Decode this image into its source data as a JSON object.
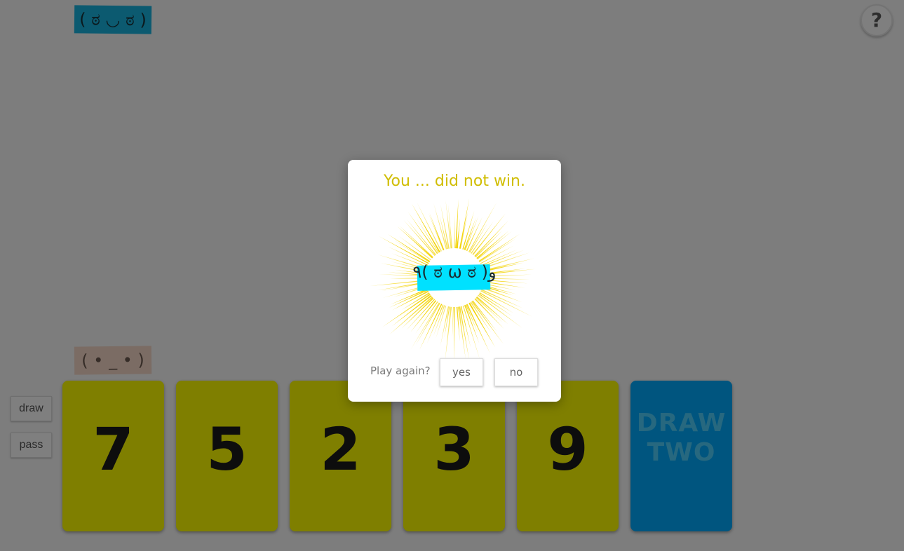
{
  "opponent": {
    "emoticon": "( ಠ ◡ ಠ )",
    "sticker_color": "#19b4e0"
  },
  "player": {
    "emoticon": "( • _ • )",
    "sticker_color": "#f6d8c8"
  },
  "help": {
    "label": "?"
  },
  "controls": {
    "draw_label": "draw",
    "pass_label": "pass"
  },
  "hand": [
    {
      "value": "7",
      "color": "#ffff00"
    },
    {
      "value": "5",
      "color": "#ffff00"
    },
    {
      "value": "2",
      "color": "#ffff00"
    },
    {
      "value": "3",
      "color": "#ffff00"
    },
    {
      "value": "9",
      "color": "#ffff00"
    },
    {
      "value": "DRAW TWO",
      "line1": "DRAW",
      "line2": "TWO",
      "color": "#00aaff"
    }
  ],
  "dialog": {
    "title": "You ... did not win.",
    "emoticon": "٩( ಠ ω ಠ )و",
    "prompt": "Play again?",
    "yes_label": "yes",
    "no_label": "no",
    "title_color": "#d0bd00",
    "burst_color": "#f2d200",
    "sticker_color": "#00e1ff"
  }
}
